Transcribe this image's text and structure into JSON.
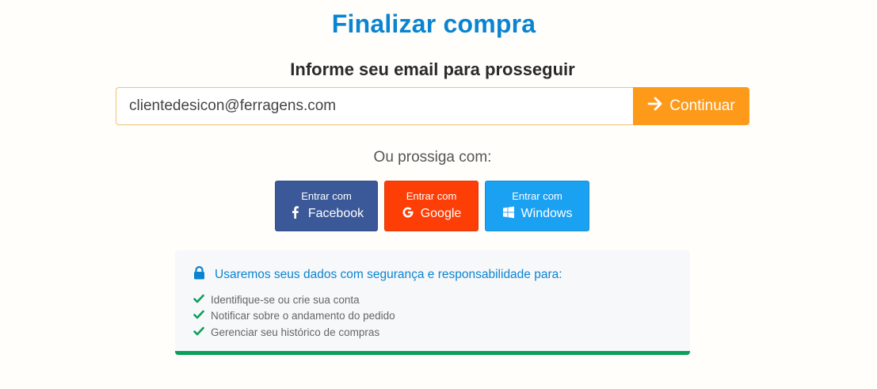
{
  "page": {
    "title": "Finalizar compra",
    "subtitle": "Informe seu email para prosseguir"
  },
  "email_form": {
    "value": "clientedesicon@ferragens.com",
    "button_label": "Continuar",
    "button_icon": "arrow-right-icon",
    "accent_color": "#fd9a19"
  },
  "social": {
    "prompt": "Ou prossiga com:",
    "buttons": [
      {
        "prefix": "Entrar com",
        "label": "Facebook",
        "icon": "facebook-icon",
        "color": "#3b5998"
      },
      {
        "prefix": "Entrar com",
        "label": "Google",
        "icon": "google-icon",
        "color": "#fd3f07"
      },
      {
        "prefix": "Entrar com",
        "label": "Windows",
        "icon": "windows-icon",
        "color": "#1ba1f2"
      }
    ]
  },
  "privacy": {
    "heading": "Usaremos seus dados com segurança e responsabilidade para:",
    "heading_icon": "lock-icon",
    "items": [
      "Identifique-se ou crie sua conta",
      "Notificar sobre o andamento do pedido",
      "Gerenciar seu histórico de compras"
    ],
    "item_icon": "check-icon",
    "accent_color": "#0aa05a"
  }
}
